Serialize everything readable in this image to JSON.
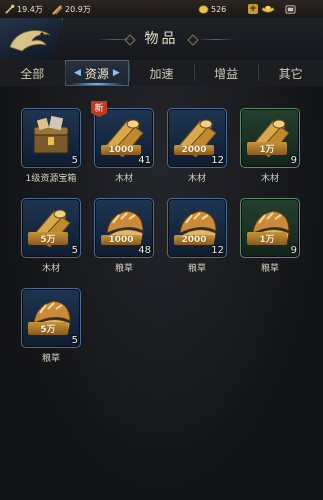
{
  "topbar": {
    "food_value": "19.4万",
    "wood_value": "20.9万",
    "gold_value": "526"
  },
  "header": {
    "title": "物品"
  },
  "tabs": [
    {
      "label": "全部",
      "active": false
    },
    {
      "label": "资源",
      "active": true
    },
    {
      "label": "加速",
      "active": false
    },
    {
      "label": "增益",
      "active": false
    },
    {
      "label": "其它",
      "active": false
    }
  ],
  "items": [
    {
      "name": "1级资源宝箱",
      "count": "5",
      "amount": "",
      "icon": "resource-chest-icon",
      "is_new": false
    },
    {
      "name": "木材",
      "count": "41",
      "amount": "1000",
      "icon": "wood-icon",
      "is_new": true
    },
    {
      "name": "木材",
      "count": "12",
      "amount": "2000",
      "icon": "wood-icon",
      "is_new": false
    },
    {
      "name": "木材",
      "count": "9",
      "amount": "1万",
      "icon": "wood-icon",
      "is_new": false
    },
    {
      "name": "木材",
      "count": "5",
      "amount": "5万",
      "icon": "wood-icon",
      "is_new": false
    },
    {
      "name": "粮草",
      "count": "48",
      "amount": "1000",
      "icon": "grain-icon",
      "is_new": false
    },
    {
      "name": "粮草",
      "count": "12",
      "amount": "2000",
      "icon": "grain-icon",
      "is_new": false
    },
    {
      "name": "粮草",
      "count": "9",
      "amount": "1万",
      "icon": "grain-icon",
      "is_new": false
    },
    {
      "name": "粮草",
      "count": "5",
      "amount": "5万",
      "icon": "grain-icon",
      "is_new": false
    }
  ],
  "new_badge_label": "新",
  "colors": {
    "slot_blue": "#1e3552",
    "slot_green": "#24402f",
    "accent": "#66b9ff"
  }
}
